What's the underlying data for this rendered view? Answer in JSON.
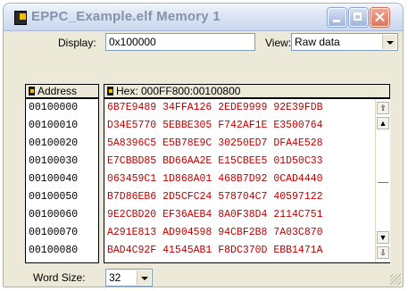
{
  "window": {
    "title": "EPPC_Example.elf Memory 1",
    "buttons": [
      "minimize",
      "maximize",
      "close"
    ]
  },
  "display": {
    "label": "Display:",
    "value": "0x100000"
  },
  "view": {
    "label": "View:",
    "selected": "Raw data"
  },
  "table": {
    "address_header": "Address",
    "hex_header": "Hex: 000FF800:00100800",
    "rows": [
      {
        "address": "00100000",
        "hex": "6B7E9489 34FFA126 2EDE9999 92E39FDB"
      },
      {
        "address": "00100010",
        "hex": "D34E5770 5EBBE305 F742AF1E E3500764"
      },
      {
        "address": "00100020",
        "hex": "5A8396C5 E5B78E9C 30250ED7 DFA4E528"
      },
      {
        "address": "00100030",
        "hex": "E7CBBD85 BD66AA2E E15CBEE5 01D50C33"
      },
      {
        "address": "00100040",
        "hex": "063459C1 1D868A01 468B7D92 0CAD4440"
      },
      {
        "address": "00100050",
        "hex": "B7D86EB6 2D5CFC24 578704C7 40597122"
      },
      {
        "address": "00100060",
        "hex": "9E2CBD20 EF36AEB4 8A0F38D4 2114C751"
      },
      {
        "address": "00100070",
        "hex": "A291E813 AD904598 94CBF2B8 7A03C870"
      },
      {
        "address": "00100080",
        "hex": "BAD4C92F 41545AB1 F8DC370D EBB1471A"
      }
    ]
  },
  "word_size": {
    "label": "Word Size:",
    "value": "32"
  },
  "colors": {
    "hex_text": "#c00000",
    "address_text": "#000000",
    "window_bg": "#ece9d8"
  }
}
